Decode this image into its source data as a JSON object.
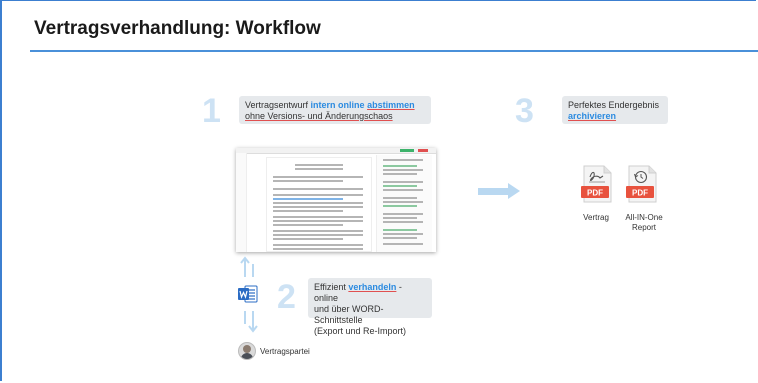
{
  "title": "Vertragsverhandlung: Workflow",
  "steps": [
    {
      "number": "1",
      "text_before": "Vertragsentwurf",
      "highlight_1": "intern online",
      "highlight_2": "abstimmen",
      "line2": "ohne Versions- und Änderungschaos"
    },
    {
      "number": "2",
      "text_before": "Effizient",
      "highlight": "verhandeln",
      "text_after": "- online",
      "line2": "und über WORD-Schnittstelle",
      "line3": "(Export und Re-Import)"
    },
    {
      "number": "3",
      "line1": "Perfektes Endergebnis",
      "highlight": "archivieren"
    }
  ],
  "outputs": [
    {
      "badge": "PDF",
      "label": "Vertrag",
      "icon": "signature-pdf-icon"
    },
    {
      "badge": "PDF",
      "label_line1": "All-IN-One",
      "label_line2": "Report",
      "icon": "history-pdf-icon"
    }
  ],
  "party_label": "Vertragspartei",
  "colors": {
    "accent": "#2c8be0",
    "rule": "#4a90d9",
    "step_number": "#cde2f4",
    "pdf": "#e8523e",
    "word": "#2b6cc4"
  }
}
